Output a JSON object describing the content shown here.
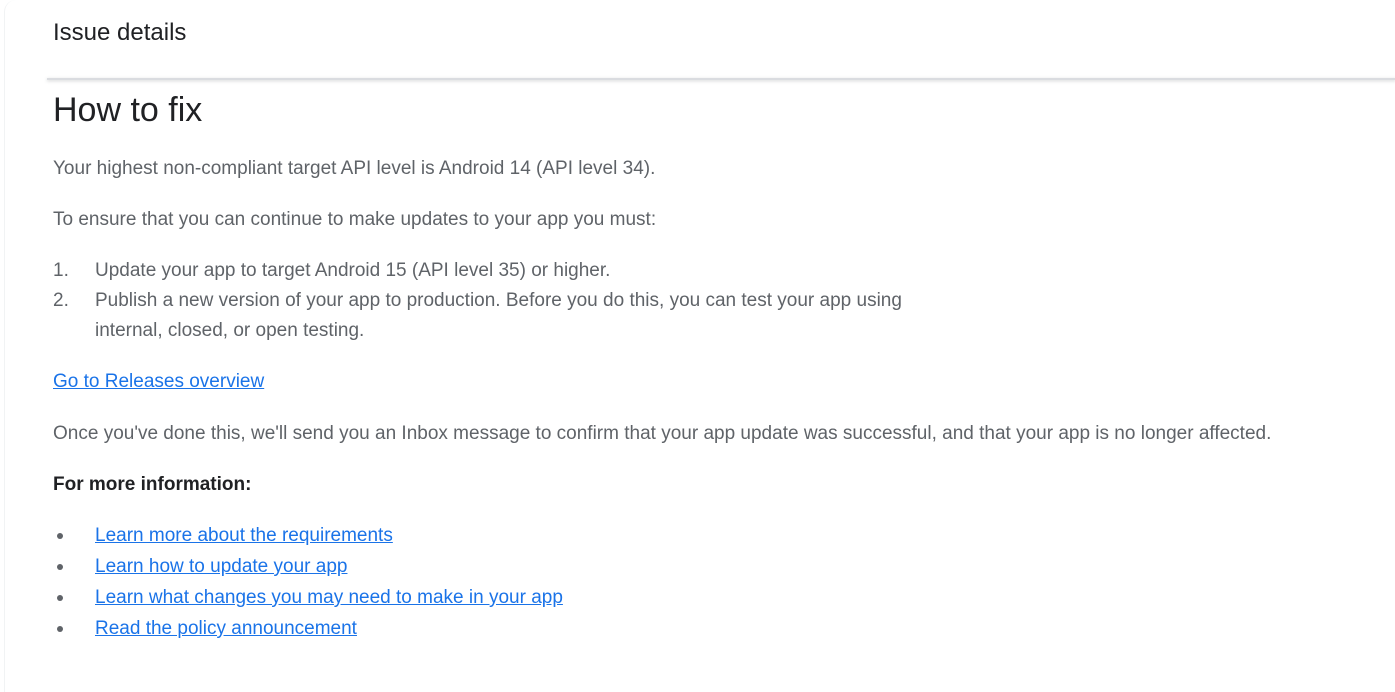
{
  "header": {
    "title": "Issue details"
  },
  "section": {
    "title": "How to fix",
    "intro": "Your highest non-compliant target API level is Android 14 (API level 34).",
    "lead": "To ensure that you can continue to make updates to your app you must:",
    "steps": [
      {
        "num": "1.",
        "text": "Update your app to target Android 15 (API level 35) or higher."
      },
      {
        "num": "2.",
        "text": "Publish a new version of your app to production. Before you do this, you can test your app using internal, closed, or open testing."
      }
    ],
    "releases_link": "Go to Releases overview",
    "confirmation": "Once you've done this, we'll send you an Inbox message to confirm that your app update was successful, and that your app is no longer affected.",
    "more_info_heading": "For more information:",
    "more_info_links": [
      "Learn more about the requirements",
      "Learn how to update your app",
      "Learn what changes you may need to make in your app",
      "Read the policy announcement"
    ]
  },
  "colors": {
    "link": "#1a73e8",
    "body_text": "#5f6368",
    "heading_text": "#202124"
  }
}
